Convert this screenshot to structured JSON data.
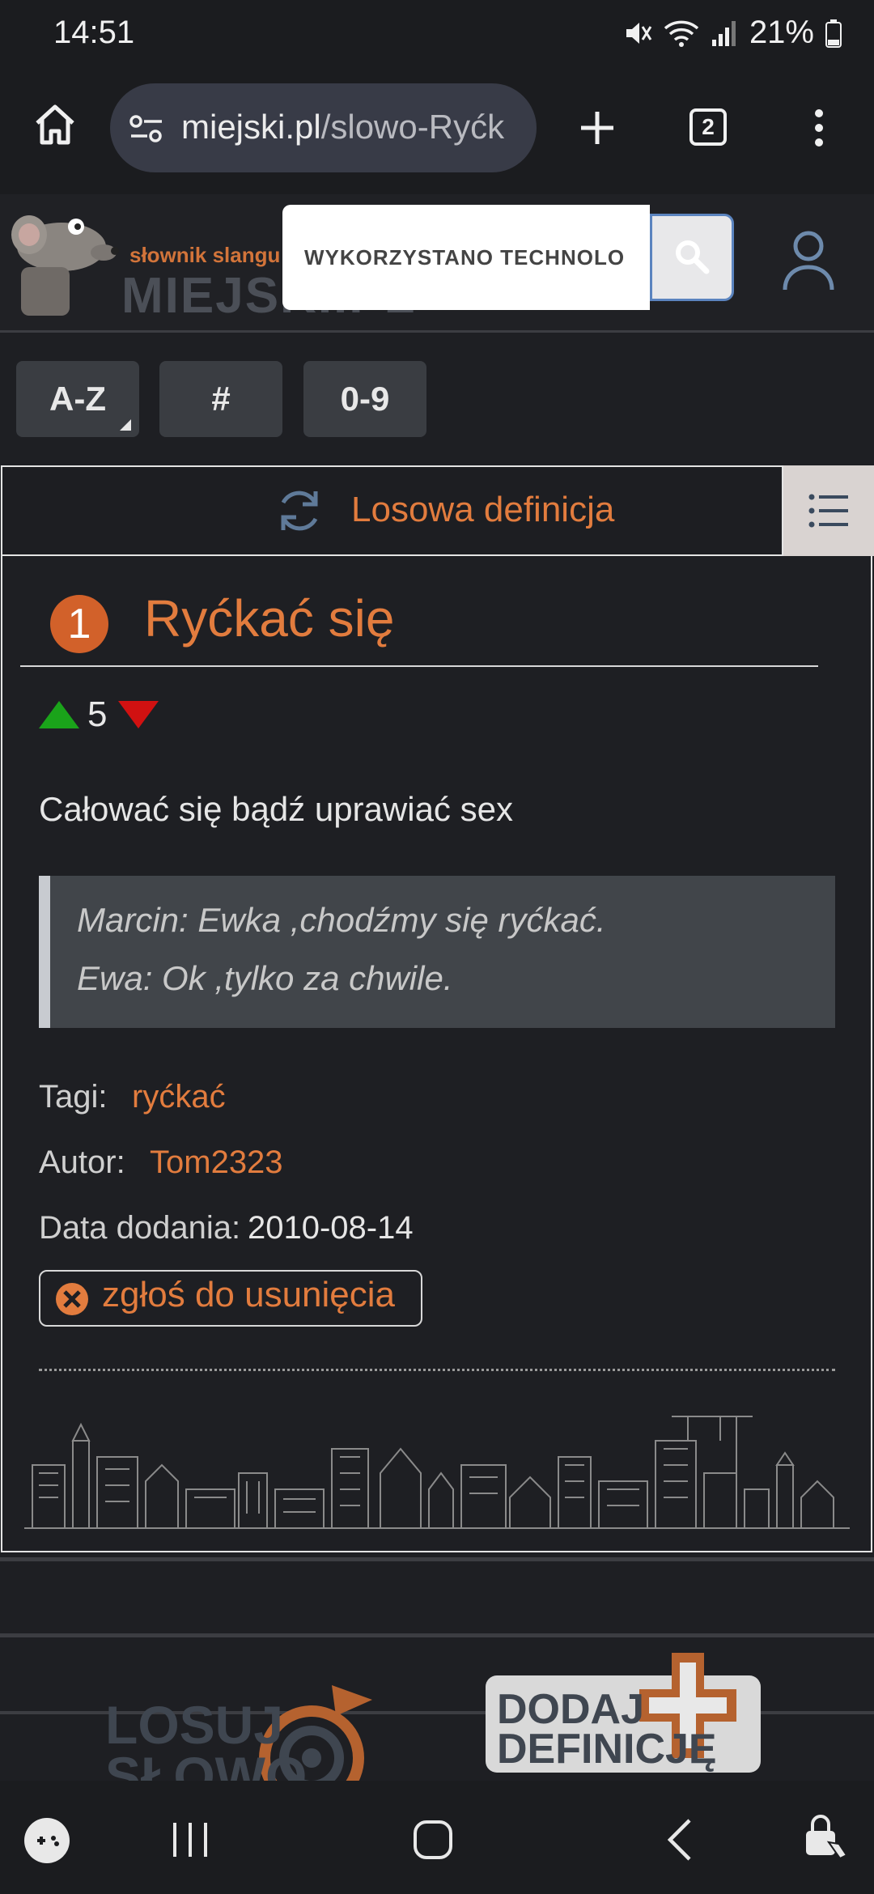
{
  "status_bar": {
    "time": "14:51",
    "battery": "21%",
    "icons": [
      "mute-icon",
      "wifi-icon",
      "signal-icon",
      "battery-icon"
    ]
  },
  "browser": {
    "url_host": "miejski.pl",
    "url_path": "/slowo-Ryćk",
    "tab_count": "2"
  },
  "site": {
    "logo_tagline": "słownik slangu",
    "logo_name": "MIEJSKI.PL",
    "search_placeholder": "WYKORZYSTANO TECHNOLOGIĘ",
    "letter_nav": [
      "A-Z",
      "#",
      "0-9"
    ],
    "random_label": "Losowa definicja"
  },
  "entry": {
    "number": "1",
    "title": "Ryćkać się",
    "votes": "5",
    "definition": "Całować się bądź uprawiać sex",
    "example_lines": [
      "Marcin: Ewka ,chodźmy się ryćkać.",
      "Ewa: Ok ,tylko za chwile."
    ],
    "tags_label": "Tagi:",
    "tag": "ryćkać",
    "author_label": "Autor:",
    "author": "Tom2323",
    "date_label": "Data dodania:",
    "date": "2010-08-14",
    "report_label": "zgłoś do usunięcia"
  },
  "promos": {
    "random_word": [
      "LOSUJ",
      "SŁOWO"
    ],
    "add_definition": [
      "DODAJ",
      "DEFINICJĘ"
    ]
  },
  "colors": {
    "accent": "#e27c3e",
    "background": "#1e1f23",
    "vote_up": "#1aa31a",
    "vote_down": "#d11111"
  }
}
